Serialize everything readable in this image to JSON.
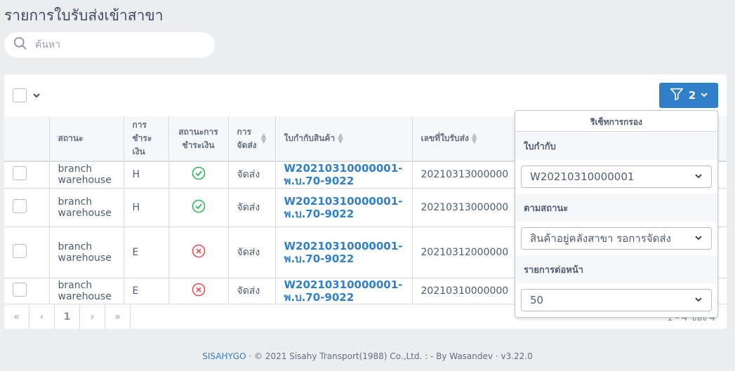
{
  "page": {
    "title": "รายการใบรับส่งเข้าสาขา"
  },
  "search": {
    "placeholder": "ค้นหา"
  },
  "toolbar": {
    "filter_count": "2"
  },
  "table": {
    "headers": {
      "status": "สถานะ",
      "payment": "การชำระเงิน",
      "payment_status": "สถานะการชำระเงิน",
      "delivery": "การจัดส่ง",
      "waybill": "ใบกำกับสินค้า",
      "receipt_no": "เลขที่ใบรับส่ง"
    },
    "rows": [
      {
        "status_line1": "branch",
        "status_line2": "warehouse",
        "payment": "H",
        "paid": true,
        "delivery": "จัดส่ง",
        "waybill_line1": "W20210310000001-",
        "waybill_line2": "พ.บ.70-9022",
        "receipt_no": "20210313000000"
      },
      {
        "status_line1": "branch",
        "status_line2": "warehouse",
        "payment": "H",
        "paid": true,
        "delivery": "จัดส่ง",
        "waybill_line1": "W20210310000001-",
        "waybill_line2": "พ.บ.70-9022",
        "receipt_no": "20210313000000"
      },
      {
        "status_line1": "branch",
        "status_line2": "warehouse",
        "payment": "E",
        "paid": false,
        "delivery": "จัดส่ง",
        "waybill_line1": "W20210310000001-",
        "waybill_line2": "พ.บ.70-9022",
        "receipt_no": "20210312000000"
      },
      {
        "status_line1": "branch",
        "status_line2": "warehouse",
        "payment": "E",
        "paid": false,
        "delivery": "จัดส่ง",
        "waybill_line1": "W20210310000001-",
        "waybill_line2": "พ.บ.70-9022",
        "receipt_no": "20210310000000"
      }
    ]
  },
  "pagination": {
    "first": "«",
    "prev": "‹",
    "page": "1",
    "next": "›",
    "last": "»",
    "summary": "1 - 4 ของ 4"
  },
  "filter_panel": {
    "title": "รีเซ็ทการกรอง",
    "waybill_label": "ใบกำกับ",
    "waybill_value": "W20210310000001",
    "status_label": "ตามสถานะ",
    "status_value": "สินค้าอยู่คลังสาขา รอการจัดส่ง",
    "per_page_label": "รายการต่อหน้า",
    "per_page_value": "50"
  },
  "footer": {
    "brand": "SISAHYGO",
    "sep1": "·",
    "copyright": "© 2021 Sisahy Transport(1988) Co.,Ltd. : - By Wasandev",
    "sep2": "·",
    "version": "v3.22.0"
  },
  "colors": {
    "accent": "#2f80c9",
    "ok": "#2eb85c",
    "error": "#e55353"
  },
  "icons": {
    "search": "search-icon",
    "filter": "filter-icon",
    "chevron": "chevron-down-icon",
    "ok": "check-circle-icon",
    "error": "x-circle-icon"
  }
}
